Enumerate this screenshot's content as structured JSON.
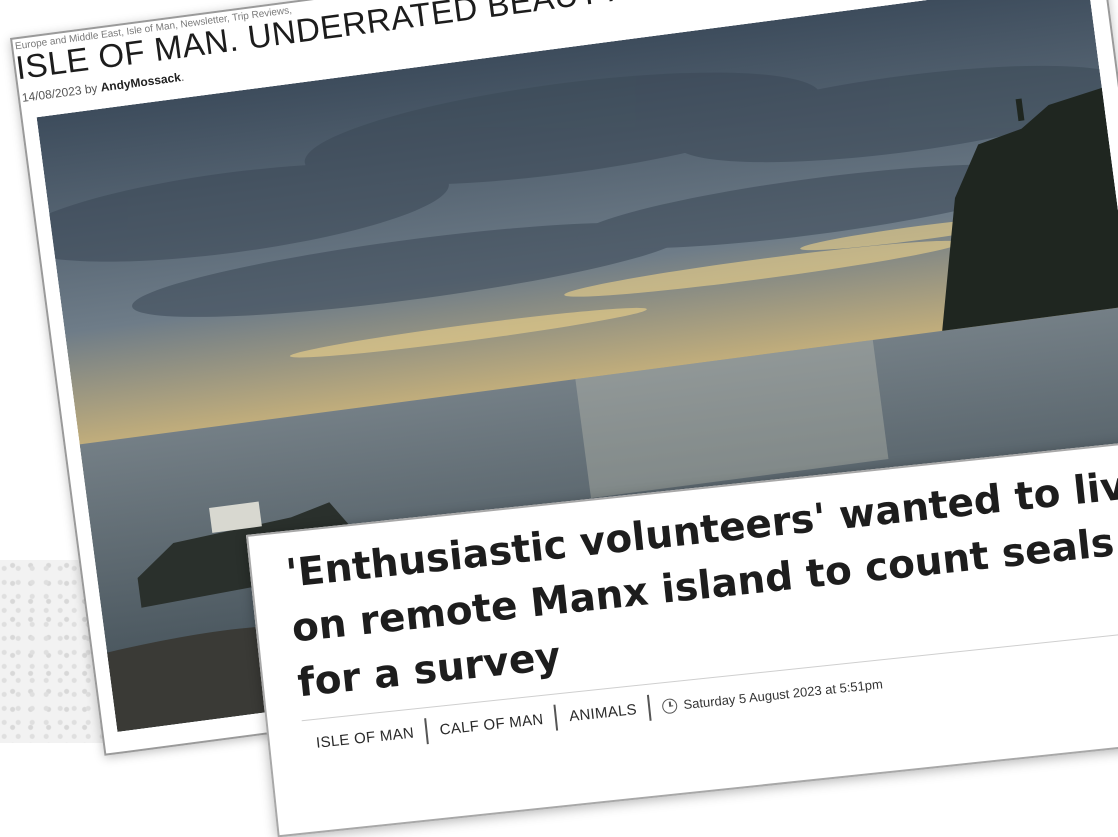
{
  "article1": {
    "categories": "Europe and Middle East, Isle of Man, Newsletter, Trip Reviews,",
    "title": "ISLE OF MAN. UNDERRATED BEAUTY IN THE",
    "date": "14/08/2023",
    "by": "by",
    "author": "AndyMossack",
    "author_suffix": "."
  },
  "article2": {
    "headline": "'Enthusiastic volunteers' wanted to live on remote Manx island to count seals for a survey",
    "tags": [
      "ISLE OF MAN",
      "CALF OF MAN",
      "ANIMALS"
    ],
    "timestamp": "Saturday 5 August 2023 at 5:51pm",
    "clock_icon": "clock-icon"
  },
  "colors": {
    "sky_top": "#3a4a5a",
    "sunset": "#e8c77a",
    "sea": "#5f6d76",
    "headland": "#1e241e"
  }
}
